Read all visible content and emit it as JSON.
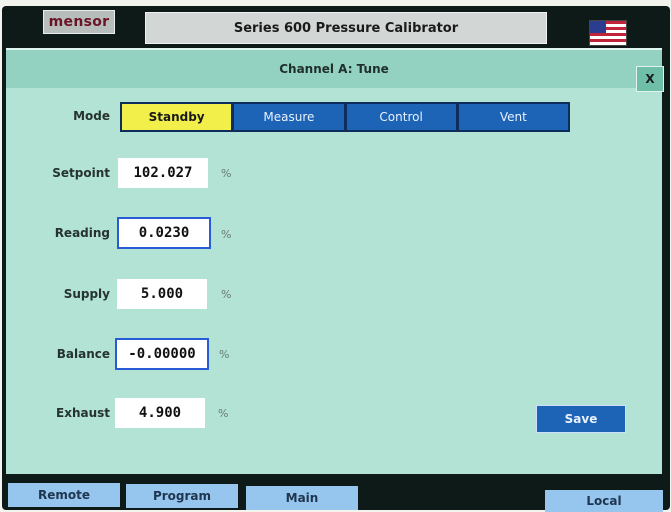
{
  "header": {
    "logo_text": "mensor",
    "title": "Series 600 Pressure Calibrator",
    "flag_icon": "us-flag-icon"
  },
  "panel": {
    "title": "Channel A: Tune",
    "close_label": "X"
  },
  "mode": {
    "label": "Mode",
    "options": [
      "Standby",
      "Measure",
      "Control",
      "Vent"
    ],
    "selected": "Standby"
  },
  "fields": [
    {
      "label": "Setpoint",
      "value": "102.027",
      "unit": "%"
    },
    {
      "label": "Reading",
      "value": "0.0230",
      "unit": "%"
    },
    {
      "label": "Supply",
      "value": "5.000",
      "unit": "%"
    },
    {
      "label": "Balance",
      "value": "-0.00000",
      "unit": "%"
    },
    {
      "label": "Exhaust",
      "value": "4.900",
      "unit": "%"
    }
  ],
  "actions": {
    "save_label": "Save"
  },
  "bottom_bar": {
    "remote": "Remote",
    "program": "Program",
    "main": "Main",
    "local": "Local"
  },
  "colors": {
    "panel_bg": "#b2e3d4",
    "active_mode": "#f2ef4a",
    "button_blue": "#1d63b6"
  }
}
